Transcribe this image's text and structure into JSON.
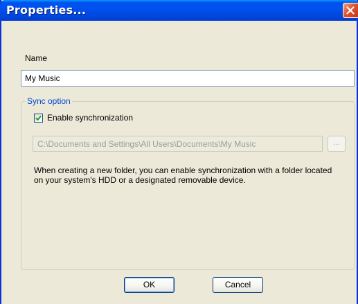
{
  "window": {
    "title": "Properties..."
  },
  "form": {
    "name_label": "Name",
    "name_value": "My Music",
    "sync_group_label": "Sync option",
    "enable_sync_label": "Enable synchronization",
    "enable_sync_checked": true,
    "path_value": "C:\\Documents and Settings\\All Users\\Documents\\My Music",
    "browse_label": "...",
    "description": "When creating a new folder, you can enable synchronization with a folder located on your system's HDD or a designated removable device."
  },
  "buttons": {
    "ok_label": "OK",
    "cancel_label": "Cancel"
  },
  "icons": {
    "close": "close-icon",
    "check": "checkmark-icon"
  },
  "colors": {
    "titlebar": "#0053ee",
    "close": "#e0532c",
    "dialog_bg": "#ece9d8",
    "group_label": "#0046d5",
    "check_mark": "#21a121"
  }
}
